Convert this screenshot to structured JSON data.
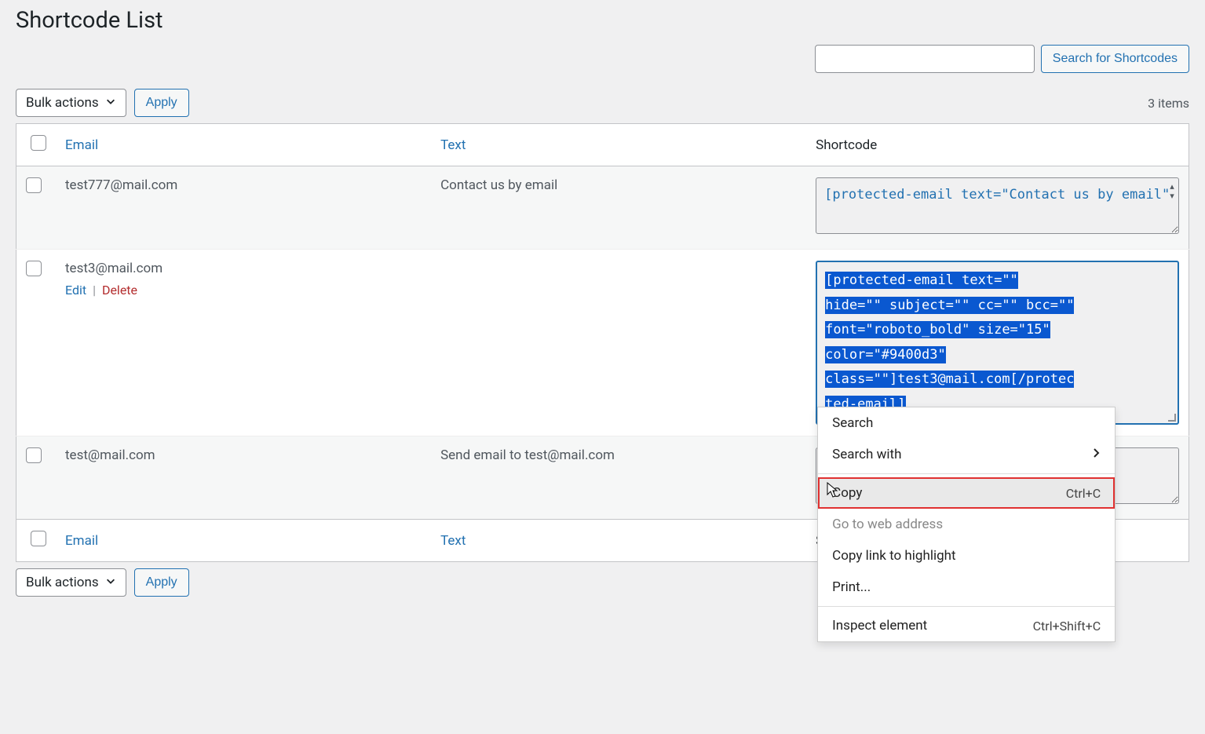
{
  "page": {
    "title": "Shortcode List"
  },
  "search": {
    "value": "",
    "button_label": "Search for Shortcodes"
  },
  "bulk": {
    "label": "Bulk actions",
    "apply_label": "Apply"
  },
  "tablenav": {
    "items_count": "3 items"
  },
  "columns": {
    "email": "Email",
    "text": "Text",
    "shortcode": "Shortcode"
  },
  "rows": [
    {
      "email": "test777@mail.com",
      "text": "Contact us by email",
      "shortcode": "[protected-email text=\"Contact us by email\"",
      "show_actions": false,
      "selected": false
    },
    {
      "email": "test3@mail.com",
      "text": "",
      "shortcode": "[protected-email text=\"\" hide=\"\" subject=\"\" cc=\"\" bcc=\"\" font=\"roboto_bold\" size=\"15\" color=\"#9400d3\" class=\"\"]test3@mail.com[/protected-email]",
      "show_actions": true,
      "selected": true
    },
    {
      "email": "test@mail.com",
      "text": "Send email to test@mail.com",
      "shortcode": "",
      "show_actions": false,
      "selected": false
    }
  ],
  "row_actions": {
    "edit": "Edit",
    "delete": "Delete"
  },
  "context_menu": {
    "search": "Search",
    "search_with": "Search with",
    "copy": "Copy",
    "copy_shortcut": "Ctrl+C",
    "goto": "Go to web address",
    "copy_link_highlight": "Copy link to highlight",
    "print": "Print...",
    "inspect": "Inspect element",
    "inspect_shortcut": "Ctrl+Shift+C"
  }
}
